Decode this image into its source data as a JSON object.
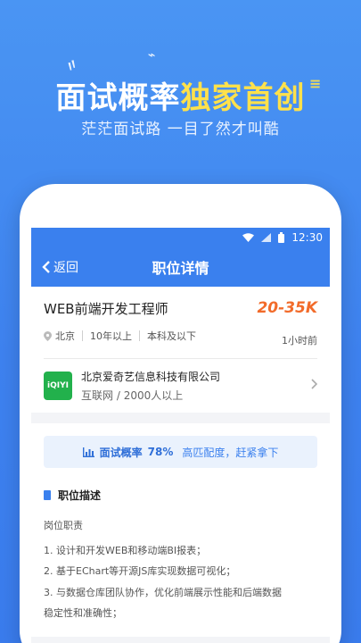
{
  "promo": {
    "headline_white": "面试概率",
    "headline_highlight": "独家首创",
    "subtitle": "茫茫面试路 一目了然才叫酷"
  },
  "status_bar": {
    "time": "12:30"
  },
  "navbar": {
    "back_label": "返回",
    "title": "职位详情"
  },
  "job": {
    "title": "WEB前端开发工程师",
    "salary": "20-35K",
    "location": "北京",
    "experience": "10年以上",
    "education": "本科及以下",
    "posted": "1小时前"
  },
  "company": {
    "logo_text": "iQIYI",
    "name": "北京爱奇艺信息科技有限公司",
    "industry": "互联网",
    "size": "2000人以上"
  },
  "rate": {
    "label": "面试概率",
    "value": "78%",
    "hint": "高匹配度，赶紧拿下"
  },
  "description": {
    "section_title": "职位描述",
    "subheading": "岗位职责",
    "lines": [
      "1. 设计和开发WEB和移动端BI报表；",
      "2. 基于EChart等开源JS库实现数据可视化；",
      "3. 与数据仓库团队协作，优化前端展示性能和后端数据",
      "稳定性和准确性；"
    ]
  },
  "colors": {
    "primary": "#3a80ee",
    "accent_yellow": "#ffe14b",
    "salary": "#f26b2a",
    "logo_green": "#22b14c"
  }
}
